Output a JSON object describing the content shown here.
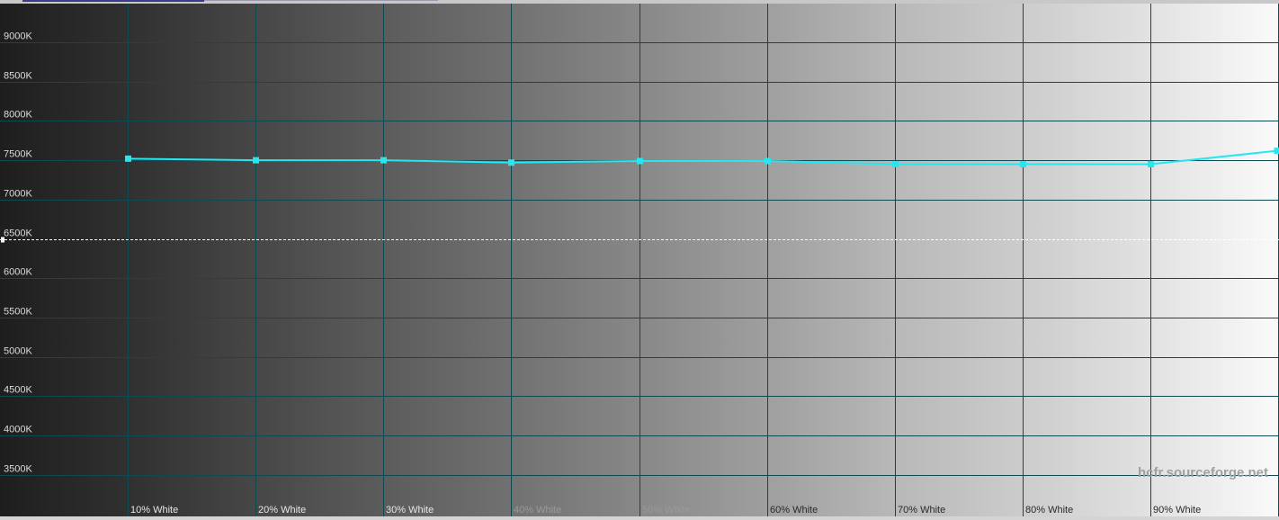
{
  "chart_data": {
    "type": "line",
    "categories": [
      "",
      "10% White",
      "20% White",
      "30% White",
      "40% White",
      "50% White",
      "60% White",
      "70% White",
      "80% White",
      "90% White",
      ""
    ],
    "series": [
      {
        "values": [
          null,
          7520,
          7500,
          7500,
          7470,
          7490,
          7490,
          7450,
          7450,
          7450,
          7620
        ]
      }
    ],
    "reference_line": 6500,
    "y_ticks": [
      "9000K",
      "8500K",
      "8000K",
      "7500K",
      "7000K",
      "6500K",
      "6000K",
      "5500K",
      "5000K",
      "4500K",
      "4000K",
      "3500K"
    ],
    "ylim": [
      3000,
      9500
    ],
    "grid": true,
    "background": "grayscale gradient dark to light",
    "line_color": "#27e6ef",
    "grid_color": "#0f4a52",
    "watermark": "hcfr.sourceforge.net"
  }
}
